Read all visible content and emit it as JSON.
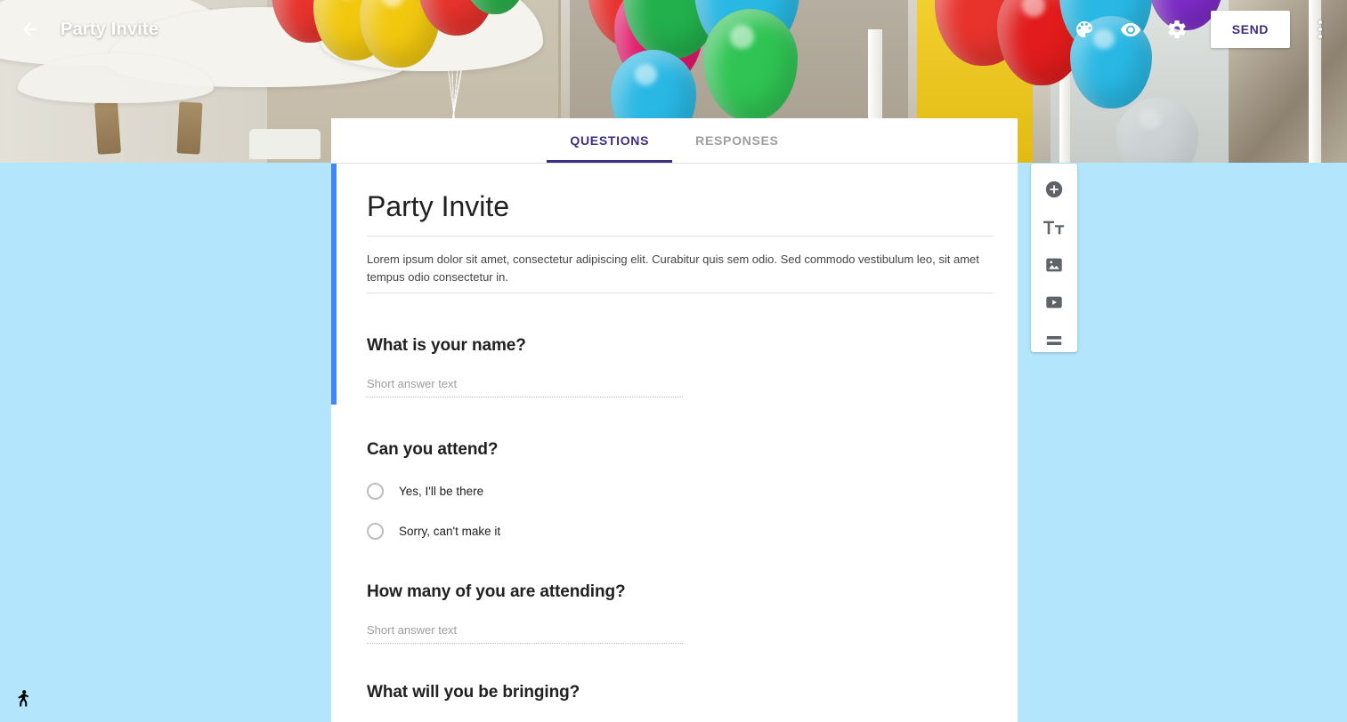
{
  "topbar": {
    "back_icon": "arrow-back-icon",
    "title": "Party Invite",
    "palette_icon": "palette-icon",
    "preview_icon": "eye-preview-icon",
    "settings_icon": "gear-settings-icon",
    "send_label": "SEND",
    "more_icon": "more-vert-icon"
  },
  "tabs": [
    {
      "label": "QUESTIONS",
      "active": true
    },
    {
      "label": "RESPONSES",
      "active": false
    }
  ],
  "form": {
    "title": "Party Invite",
    "description": "Lorem ipsum dolor sit amet, consectetur adipiscing elit. Curabitur quis sem odio. Sed commodo vestibulum leo, sit amet tempus odio consectetur in.",
    "questions": [
      {
        "title": "What is your name?",
        "type": "short-answer",
        "placeholder": "Short answer text"
      },
      {
        "title": "Can you attend?",
        "type": "multiple-choice",
        "options": [
          "Yes,  I'll be there",
          "Sorry, can't make it"
        ]
      },
      {
        "title": "How many of you are attending?",
        "type": "short-answer",
        "placeholder": "Short answer text"
      },
      {
        "title": "What will you be bringing?",
        "type": "checkbox"
      }
    ]
  },
  "side_toolbar": [
    {
      "icon": "add-question-icon",
      "label": "Add question"
    },
    {
      "icon": "add-title-icon",
      "label": "Add title and description"
    },
    {
      "icon": "add-image-icon",
      "label": "Add image"
    },
    {
      "icon": "add-video-icon",
      "label": "Add video"
    },
    {
      "icon": "add-section-icon",
      "label": "Add section"
    }
  ],
  "accessibility": {
    "icon": "accessibility-run-icon"
  },
  "colors": {
    "page_background": "#b3e5fc",
    "accent_purple": "#3c2f80",
    "selection_blue": "#4285f4",
    "card_white": "#ffffff"
  }
}
